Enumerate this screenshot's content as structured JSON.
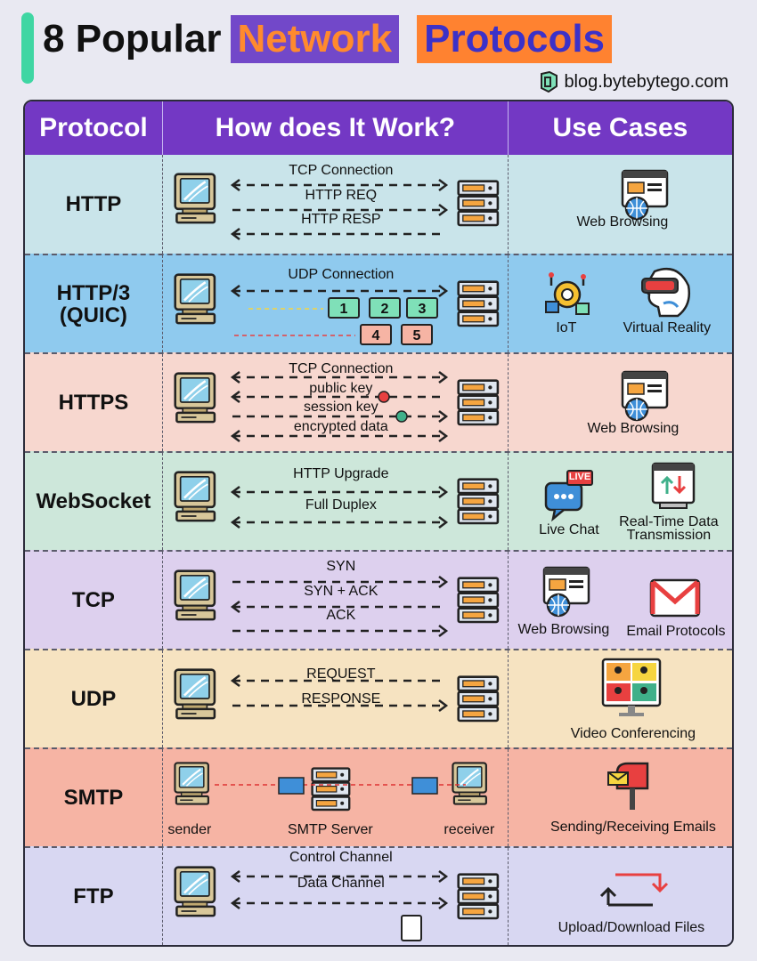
{
  "header": {
    "title_prefix": "8 Popular",
    "title_word1": "Network",
    "title_word2": "Protocols",
    "blog": "blog.bytebytego.com",
    "logo_icon": "bytebytego-logo-icon"
  },
  "columns": {
    "protocol": "Protocol",
    "how": "How does It Work?",
    "use": "Use Cases"
  },
  "colors": {
    "header_bg": "#7338c4",
    "net_chip": "#7248c9",
    "pro_chip": "#ff8230",
    "accent": "#3fd6a3"
  },
  "rows": [
    {
      "protocol": "HTTP",
      "bg": "#c9e4ea",
      "steps": [
        "TCP Connection",
        "HTTP REQ",
        "HTTP RESP"
      ],
      "uses": [
        "Web Browsing"
      ]
    },
    {
      "protocol": "HTTP/3\n(QUIC)",
      "bg": "#8fcaee",
      "steps": [
        "UDP Connection"
      ],
      "packets": [
        "1",
        "2",
        "3",
        "4",
        "5"
      ],
      "uses": [
        "IoT",
        "Virtual Reality"
      ]
    },
    {
      "protocol": "HTTPS",
      "bg": "#f7d7cf",
      "steps": [
        "TCP Connection",
        "public key",
        "session key",
        "encrypted data"
      ],
      "uses": [
        "Web Browsing"
      ]
    },
    {
      "protocol": "WebSocket",
      "bg": "#cde7da",
      "steps": [
        "HTTP Upgrade",
        "Full Duplex"
      ],
      "uses": [
        "Live Chat",
        "Real-Time Data\nTransmission"
      ],
      "badge": "LIVE"
    },
    {
      "protocol": "TCP",
      "bg": "#ddd0ee",
      "steps": [
        "SYN",
        "SYN + ACK",
        "ACK"
      ],
      "uses": [
        "Web Browsing",
        "Email Protocols"
      ]
    },
    {
      "protocol": "UDP",
      "bg": "#f6e3c1",
      "steps": [
        "REQUEST",
        "RESPONSE"
      ],
      "uses": [
        "Video Conferencing"
      ]
    },
    {
      "protocol": "SMTP",
      "bg": "#f6b4a4",
      "nodes": [
        "sender",
        "SMTP Server",
        "receiver"
      ],
      "uses": [
        "Sending/Receiving Emails"
      ]
    },
    {
      "protocol": "FTP",
      "bg": "#d8d7f2",
      "steps": [
        "Control Channel",
        "Data Channel"
      ],
      "uses": [
        "Upload/Download Files"
      ]
    }
  ]
}
